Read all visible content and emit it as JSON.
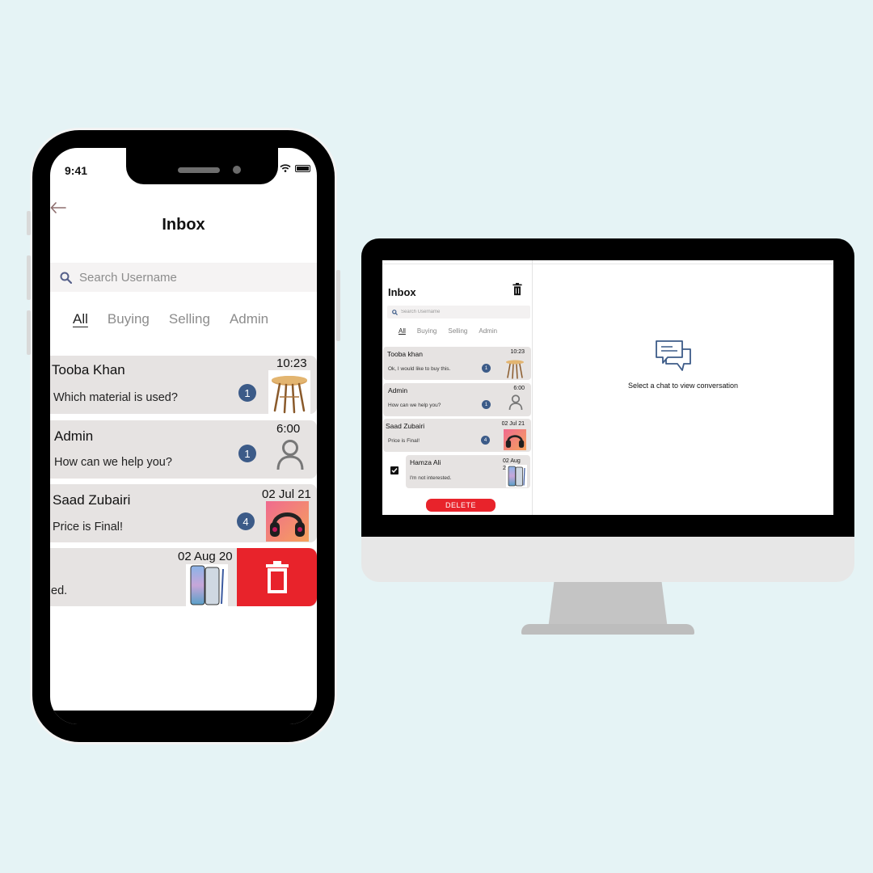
{
  "phone": {
    "status_time": "9:41",
    "title": "Inbox",
    "search_placeholder": "Search Username",
    "tabs": [
      {
        "label": "All",
        "active": true
      },
      {
        "label": "Buying",
        "active": false
      },
      {
        "label": "Selling",
        "active": false
      },
      {
        "label": "Admin",
        "active": false
      }
    ],
    "chats": [
      {
        "name": "Tooba Khan",
        "message": "Which material is used?",
        "time": "10:23",
        "unread": "1",
        "thumb": "table-image"
      },
      {
        "name": "Admin",
        "message": "How can we help you?",
        "time": "6:00",
        "unread": "1",
        "thumb": "user-icon"
      },
      {
        "name": "Saad Zubairi",
        "message": "Price is Final!",
        "time": "02 Jul 21",
        "unread": "4",
        "thumb": "headphones-image"
      },
      {
        "name": "",
        "message": "ed.",
        "time": "02 Aug 20",
        "unread": "",
        "thumb": "phone-image"
      }
    ],
    "delete_icon": "trash-icon"
  },
  "desktop": {
    "title": "Inbox",
    "search_placeholder": "Search Username",
    "tabs": [
      {
        "label": "All",
        "active": true
      },
      {
        "label": "Buying",
        "active": false
      },
      {
        "label": "Selling",
        "active": false
      },
      {
        "label": "Admin",
        "active": false
      }
    ],
    "chats": [
      {
        "name": "Tooba khan",
        "message": "Ok, I would like to buy this.",
        "time": "10:23",
        "unread": "1",
        "thumb": "table-image"
      },
      {
        "name": "Admin",
        "message": "How can we help you?",
        "time": "6:00",
        "unread": "1",
        "thumb": "user-icon"
      },
      {
        "name": "Saad Zubairi",
        "message": "Price is Final!",
        "time": "02 Jul 21",
        "unread": "4",
        "thumb": "headphones-image"
      },
      {
        "name": "Hamza Ali",
        "message": "I'm not interested.",
        "time": "02 Aug 20",
        "unread": "",
        "thumb": "phone-image",
        "selected": true
      }
    ],
    "delete_label": "DELETE",
    "empty_state": "Select a chat to view conversation"
  },
  "colors": {
    "background": "#e5f3f5",
    "row": "#e6e3e2",
    "badge": "#3c5b88",
    "delete": "#e8232b"
  }
}
